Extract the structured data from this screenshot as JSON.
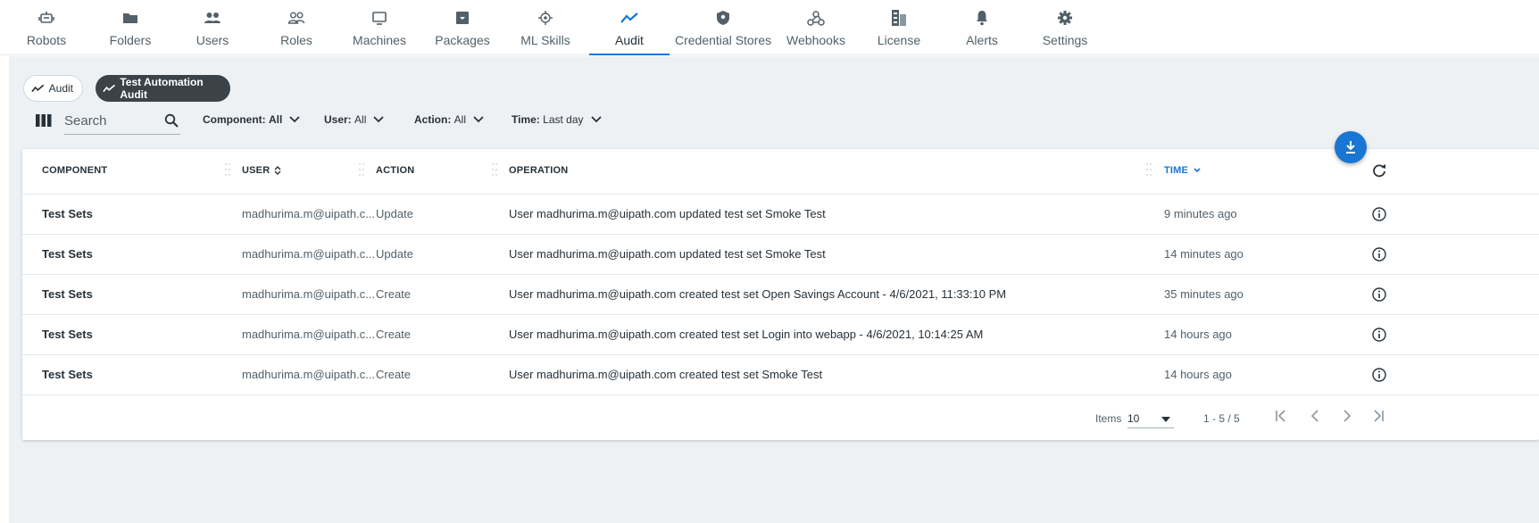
{
  "nav": {
    "items": [
      {
        "label": "Robots",
        "icon": "robot-icon"
      },
      {
        "label": "Folders",
        "icon": "folder-icon"
      },
      {
        "label": "Users",
        "icon": "users-icon"
      },
      {
        "label": "Roles",
        "icon": "roles-icon"
      },
      {
        "label": "Machines",
        "icon": "machine-icon"
      },
      {
        "label": "Packages",
        "icon": "package-icon"
      },
      {
        "label": "ML Skills",
        "icon": "ml-skills-icon"
      },
      {
        "label": "Audit",
        "icon": "audit-icon"
      },
      {
        "label": "Credential Stores",
        "icon": "shield-icon"
      },
      {
        "label": "Webhooks",
        "icon": "webhook-icon"
      },
      {
        "label": "License",
        "icon": "license-icon"
      },
      {
        "label": "Alerts",
        "icon": "bell-icon"
      },
      {
        "label": "Settings",
        "icon": "gear-icon"
      }
    ],
    "active": "Audit"
  },
  "chips": {
    "audit": "Audit",
    "test_automation_audit": "Test Automation Audit"
  },
  "filters": {
    "search_placeholder": "Search",
    "component": {
      "label": "Component:",
      "value": "All"
    },
    "user": {
      "label": "User:",
      "value": "All"
    },
    "action": {
      "label": "Action:",
      "value": "All"
    },
    "time": {
      "label": "Time:",
      "value": "Last day"
    }
  },
  "table": {
    "columns": {
      "component": "COMPONENT",
      "user": "USER",
      "action": "ACTION",
      "operation": "OPERATION",
      "time": "TIME"
    },
    "rows": [
      {
        "component": "Test Sets",
        "user": "madhurima.m@uipath.c...",
        "action": "Update",
        "operation": "User madhurima.m@uipath.com updated test set Smoke Test",
        "time": "9 minutes ago"
      },
      {
        "component": "Test Sets",
        "user": "madhurima.m@uipath.c...",
        "action": "Update",
        "operation": "User madhurima.m@uipath.com updated test set Smoke Test",
        "time": "14 minutes ago"
      },
      {
        "component": "Test Sets",
        "user": "madhurima.m@uipath.c...",
        "action": "Create",
        "operation": "User madhurima.m@uipath.com created test set Open Savings Account - 4/6/2021, 11:33:10 PM",
        "time": "35 minutes ago"
      },
      {
        "component": "Test Sets",
        "user": "madhurima.m@uipath.c...",
        "action": "Create",
        "operation": "User madhurima.m@uipath.com created test set Login into webapp - 4/6/2021, 10:14:25 AM",
        "time": "14 hours ago"
      },
      {
        "component": "Test Sets",
        "user": "madhurima.m@uipath.c...",
        "action": "Create",
        "operation": "User madhurima.m@uipath.com created test set Smoke Test",
        "time": "14 hours ago"
      }
    ]
  },
  "pagination": {
    "items_label": "Items",
    "page_size": "10",
    "range": "1 - 5 / 5"
  },
  "colors": {
    "accent": "#1976d2",
    "text": "#273139",
    "muted": "#526069",
    "background": "#eef1f4"
  }
}
